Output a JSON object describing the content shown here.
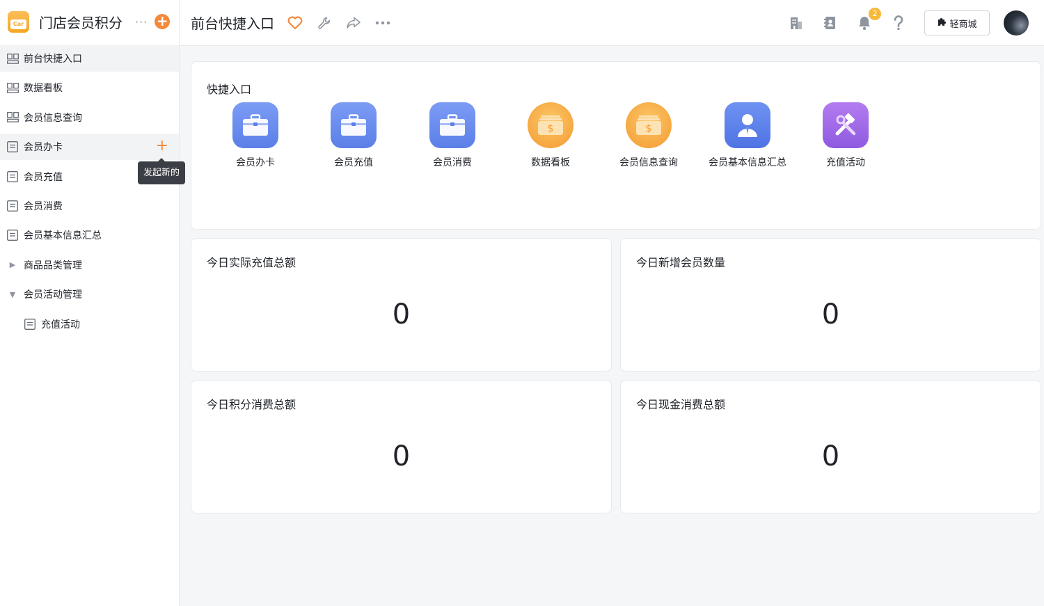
{
  "app": {
    "logo_text": "Car",
    "title": "门店会员积分",
    "more": "···",
    "add": "+"
  },
  "sidebar": {
    "items": [
      {
        "label": "前台快捷入口",
        "icon": "dashboard-icon"
      },
      {
        "label": "数据看板",
        "icon": "dashboard-icon"
      },
      {
        "label": "会员信息查询",
        "icon": "dashboard-icon"
      },
      {
        "label": "会员办卡",
        "icon": "form-icon",
        "action": "+"
      },
      {
        "label": "会员充值",
        "icon": "form-icon"
      },
      {
        "label": "会员消费",
        "icon": "form-icon"
      },
      {
        "label": "会员基本信息汇总",
        "icon": "form-icon"
      },
      {
        "label": "商品品类管理",
        "icon": "caret-right-icon"
      },
      {
        "label": "会员活动管理",
        "icon": "caret-down-icon"
      },
      {
        "label": "充值活动",
        "icon": "form-icon"
      }
    ],
    "tooltip": "发起新的"
  },
  "topbar": {
    "title": "前台快捷入口",
    "notification_count": "2",
    "mall_label": "轻商城"
  },
  "quick_entry": {
    "title": "快捷入口",
    "items": [
      {
        "label": "会员办卡",
        "icon": "briefcase-icon"
      },
      {
        "label": "会员充值",
        "icon": "briefcase-icon"
      },
      {
        "label": "会员消费",
        "icon": "briefcase-icon"
      },
      {
        "label": "数据看板",
        "icon": "money-icon"
      },
      {
        "label": "会员信息查询",
        "icon": "money-icon"
      },
      {
        "label": "会员基本信息汇总",
        "icon": "person-icon"
      },
      {
        "label": "充值活动",
        "icon": "tools-icon"
      }
    ]
  },
  "stats": [
    {
      "title": "今日实际充值总额",
      "value": "0"
    },
    {
      "title": "今日新增会员数量",
      "value": "0"
    },
    {
      "title": "今日积分消费总额",
      "value": "0"
    },
    {
      "title": "今日现金消费总额",
      "value": "0"
    }
  ],
  "colors": {
    "accent_orange": "#f5893a",
    "badge": "#f6b93b",
    "blue_icon": "#5b7fe8",
    "purple_icon": "#8e5ae0"
  }
}
